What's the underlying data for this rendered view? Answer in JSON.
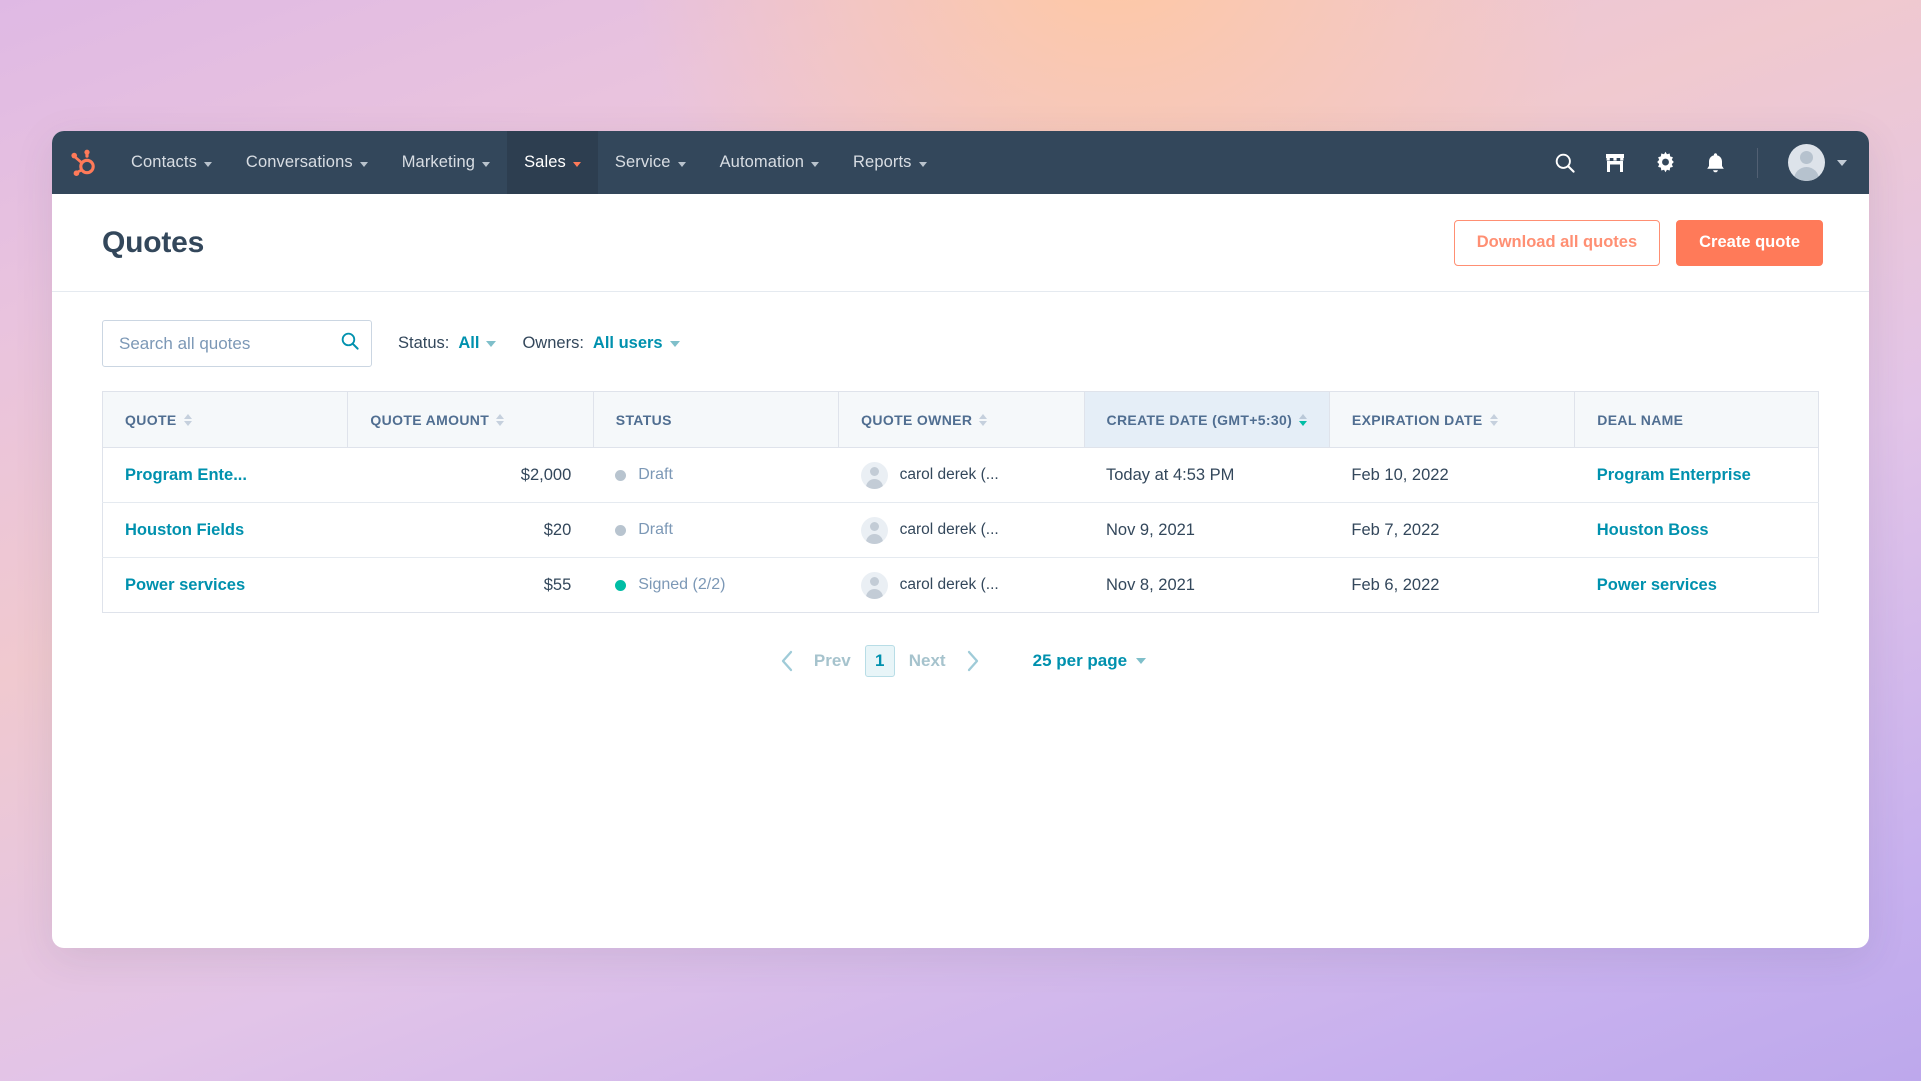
{
  "nav": {
    "logo_icon": "hubspot-sprocket-logo",
    "items": [
      {
        "label": "Contacts",
        "active": false
      },
      {
        "label": "Conversations",
        "active": false
      },
      {
        "label": "Marketing",
        "active": false
      },
      {
        "label": "Sales",
        "active": true
      },
      {
        "label": "Service",
        "active": false
      },
      {
        "label": "Automation",
        "active": false
      },
      {
        "label": "Reports",
        "active": false
      }
    ],
    "right_icons": [
      "search-icon",
      "marketplace-icon",
      "gear-icon",
      "notifications-bell-icon"
    ]
  },
  "header": {
    "title": "Quotes",
    "download_label": "Download all quotes",
    "create_label": "Create quote"
  },
  "filters": {
    "search_placeholder": "Search all quotes",
    "search_value": "",
    "status_label": "Status:",
    "status_value": "All",
    "owners_label": "Owners:",
    "owners_value": "All users"
  },
  "table": {
    "columns": [
      {
        "label": "QUOTE",
        "sortable": true,
        "sorted": false
      },
      {
        "label": "QUOTE AMOUNT",
        "sortable": true,
        "sorted": false
      },
      {
        "label": "STATUS",
        "sortable": false,
        "sorted": false
      },
      {
        "label": "QUOTE OWNER",
        "sortable": true,
        "sorted": false
      },
      {
        "label": "CREATE DATE (GMT+5:30)",
        "sortable": true,
        "sorted": true,
        "direction": "desc"
      },
      {
        "label": "EXPIRATION DATE",
        "sortable": true,
        "sorted": false
      },
      {
        "label": "DEAL NAME",
        "sortable": false,
        "sorted": false
      }
    ],
    "rows": [
      {
        "quote": "Program Ente...",
        "amount": "$2,000",
        "status": "Draft",
        "status_type": "draft",
        "owner": "carol derek (...",
        "create_date": "Today at 4:53 PM",
        "expiration_date": "Feb 10, 2022",
        "deal_name": "Program Enterprise"
      },
      {
        "quote": "Houston Fields",
        "amount": "$20",
        "status": "Draft",
        "status_type": "draft",
        "owner": "carol derek (...",
        "create_date": "Nov 9, 2021",
        "expiration_date": "Feb 7, 2022",
        "deal_name": "Houston Boss"
      },
      {
        "quote": "Power services",
        "amount": "$55",
        "status": "Signed (2/2)",
        "status_type": "signed",
        "owner": "carol derek (...",
        "create_date": "Nov 8, 2021",
        "expiration_date": "Feb 6, 2022",
        "deal_name": "Power services"
      }
    ]
  },
  "pagination": {
    "prev_label": "Prev",
    "current_page": "1",
    "next_label": "Next",
    "per_page_label": "25 per page"
  },
  "colors": {
    "nav_bg": "#33475b",
    "primary": "#ff7a59",
    "link": "#0091ae",
    "signed": "#00bda5",
    "draft": "#b8c4cf"
  }
}
